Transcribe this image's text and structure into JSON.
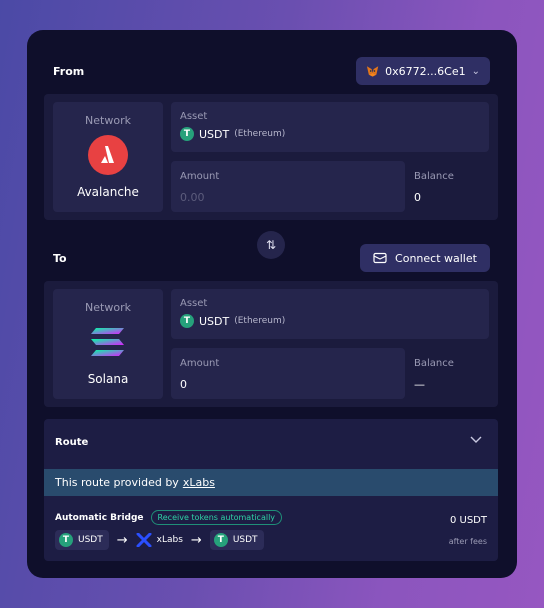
{
  "from": {
    "title": "From",
    "wallet_address": "0x6772...6Ce1",
    "network_label": "Network",
    "network_name": "Avalanche",
    "asset_label": "Asset",
    "asset_symbol": "USDT",
    "asset_chain": "(Ethereum)",
    "amount_label": "Amount",
    "amount_placeholder": "0.00",
    "balance_label": "Balance",
    "balance_value": "0"
  },
  "swap": {
    "icon": "swap-vertical-icon"
  },
  "to": {
    "title": "To",
    "connect_label": "Connect wallet",
    "network_label": "Network",
    "network_name": "Solana",
    "asset_label": "Asset",
    "asset_symbol": "USDT",
    "asset_chain": "(Ethereum)",
    "amount_label": "Amount",
    "amount_value": "0",
    "balance_label": "Balance",
    "balance_value": "—"
  },
  "route": {
    "title": "Route",
    "banner_text": "This route provided by",
    "provider": "xLabs",
    "bridge_name": "Automatic Bridge",
    "badge": "Receive tokens automatically",
    "steps": [
      "USDT",
      "xLabs",
      "USDT"
    ],
    "receive_amount": "0 USDT",
    "after_fees": "after fees"
  },
  "colors": {
    "card_bg": "#0f0f2b",
    "panel_bg": "#1b1b3d",
    "button_bg": "#2f2f64",
    "avalanche_red": "#e84142",
    "tether_green": "#26a17b",
    "banner_bg": "#294b6d",
    "badge_green": "#2fd1a5"
  }
}
